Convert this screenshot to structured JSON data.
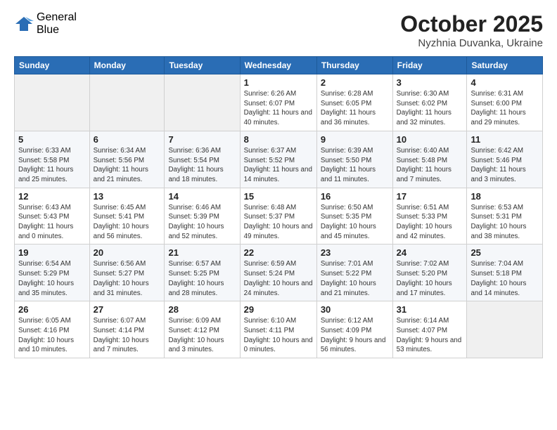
{
  "logo": {
    "general": "General",
    "blue": "Blue"
  },
  "header": {
    "month": "October 2025",
    "location": "Nyzhnia Duvanka, Ukraine"
  },
  "days_of_week": [
    "Sunday",
    "Monday",
    "Tuesday",
    "Wednesday",
    "Thursday",
    "Friday",
    "Saturday"
  ],
  "weeks": [
    [
      {
        "day": "",
        "info": ""
      },
      {
        "day": "",
        "info": ""
      },
      {
        "day": "",
        "info": ""
      },
      {
        "day": "1",
        "info": "Sunrise: 6:26 AM\nSunset: 6:07 PM\nDaylight: 11 hours\nand 40 minutes."
      },
      {
        "day": "2",
        "info": "Sunrise: 6:28 AM\nSunset: 6:05 PM\nDaylight: 11 hours\nand 36 minutes."
      },
      {
        "day": "3",
        "info": "Sunrise: 6:30 AM\nSunset: 6:02 PM\nDaylight: 11 hours\nand 32 minutes."
      },
      {
        "day": "4",
        "info": "Sunrise: 6:31 AM\nSunset: 6:00 PM\nDaylight: 11 hours\nand 29 minutes."
      }
    ],
    [
      {
        "day": "5",
        "info": "Sunrise: 6:33 AM\nSunset: 5:58 PM\nDaylight: 11 hours\nand 25 minutes."
      },
      {
        "day": "6",
        "info": "Sunrise: 6:34 AM\nSunset: 5:56 PM\nDaylight: 11 hours\nand 21 minutes."
      },
      {
        "day": "7",
        "info": "Sunrise: 6:36 AM\nSunset: 5:54 PM\nDaylight: 11 hours\nand 18 minutes."
      },
      {
        "day": "8",
        "info": "Sunrise: 6:37 AM\nSunset: 5:52 PM\nDaylight: 11 hours\nand 14 minutes."
      },
      {
        "day": "9",
        "info": "Sunrise: 6:39 AM\nSunset: 5:50 PM\nDaylight: 11 hours\nand 11 minutes."
      },
      {
        "day": "10",
        "info": "Sunrise: 6:40 AM\nSunset: 5:48 PM\nDaylight: 11 hours\nand 7 minutes."
      },
      {
        "day": "11",
        "info": "Sunrise: 6:42 AM\nSunset: 5:46 PM\nDaylight: 11 hours\nand 3 minutes."
      }
    ],
    [
      {
        "day": "12",
        "info": "Sunrise: 6:43 AM\nSunset: 5:43 PM\nDaylight: 11 hours\nand 0 minutes."
      },
      {
        "day": "13",
        "info": "Sunrise: 6:45 AM\nSunset: 5:41 PM\nDaylight: 10 hours\nand 56 minutes."
      },
      {
        "day": "14",
        "info": "Sunrise: 6:46 AM\nSunset: 5:39 PM\nDaylight: 10 hours\nand 52 minutes."
      },
      {
        "day": "15",
        "info": "Sunrise: 6:48 AM\nSunset: 5:37 PM\nDaylight: 10 hours\nand 49 minutes."
      },
      {
        "day": "16",
        "info": "Sunrise: 6:50 AM\nSunset: 5:35 PM\nDaylight: 10 hours\nand 45 minutes."
      },
      {
        "day": "17",
        "info": "Sunrise: 6:51 AM\nSunset: 5:33 PM\nDaylight: 10 hours\nand 42 minutes."
      },
      {
        "day": "18",
        "info": "Sunrise: 6:53 AM\nSunset: 5:31 PM\nDaylight: 10 hours\nand 38 minutes."
      }
    ],
    [
      {
        "day": "19",
        "info": "Sunrise: 6:54 AM\nSunset: 5:29 PM\nDaylight: 10 hours\nand 35 minutes."
      },
      {
        "day": "20",
        "info": "Sunrise: 6:56 AM\nSunset: 5:27 PM\nDaylight: 10 hours\nand 31 minutes."
      },
      {
        "day": "21",
        "info": "Sunrise: 6:57 AM\nSunset: 5:25 PM\nDaylight: 10 hours\nand 28 minutes."
      },
      {
        "day": "22",
        "info": "Sunrise: 6:59 AM\nSunset: 5:24 PM\nDaylight: 10 hours\nand 24 minutes."
      },
      {
        "day": "23",
        "info": "Sunrise: 7:01 AM\nSunset: 5:22 PM\nDaylight: 10 hours\nand 21 minutes."
      },
      {
        "day": "24",
        "info": "Sunrise: 7:02 AM\nSunset: 5:20 PM\nDaylight: 10 hours\nand 17 minutes."
      },
      {
        "day": "25",
        "info": "Sunrise: 7:04 AM\nSunset: 5:18 PM\nDaylight: 10 hours\nand 14 minutes."
      }
    ],
    [
      {
        "day": "26",
        "info": "Sunrise: 6:05 AM\nSunset: 4:16 PM\nDaylight: 10 hours\nand 10 minutes."
      },
      {
        "day": "27",
        "info": "Sunrise: 6:07 AM\nSunset: 4:14 PM\nDaylight: 10 hours\nand 7 minutes."
      },
      {
        "day": "28",
        "info": "Sunrise: 6:09 AM\nSunset: 4:12 PM\nDaylight: 10 hours\nand 3 minutes."
      },
      {
        "day": "29",
        "info": "Sunrise: 6:10 AM\nSunset: 4:11 PM\nDaylight: 10 hours\nand 0 minutes."
      },
      {
        "day": "30",
        "info": "Sunrise: 6:12 AM\nSunset: 4:09 PM\nDaylight: 9 hours\nand 56 minutes."
      },
      {
        "day": "31",
        "info": "Sunrise: 6:14 AM\nSunset: 4:07 PM\nDaylight: 9 hours\nand 53 minutes."
      },
      {
        "day": "",
        "info": ""
      }
    ]
  ]
}
